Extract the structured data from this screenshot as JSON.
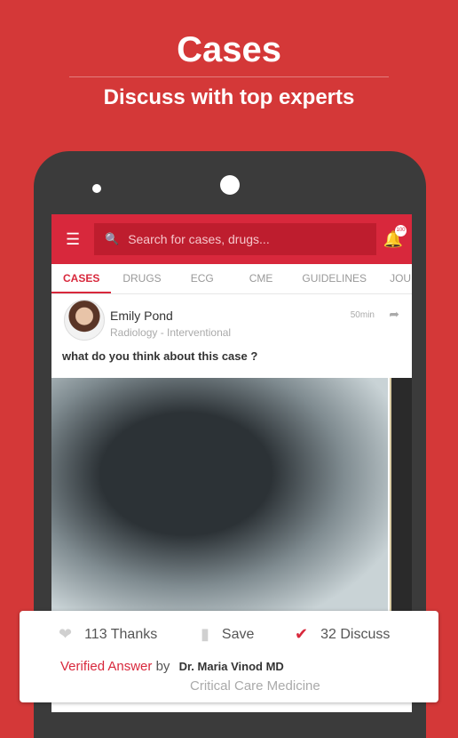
{
  "hero": {
    "title": "Cases",
    "subtitle": "Discuss with top experts"
  },
  "app": {
    "search_placeholder": "Search for cases, drugs...",
    "notification_badge": "100",
    "tabs": [
      {
        "label": "CASES",
        "active": true
      },
      {
        "label": "DRUGS"
      },
      {
        "label": "ECG"
      },
      {
        "label": "CME"
      },
      {
        "label": "GUIDELINES"
      },
      {
        "label": "JOURNA"
      }
    ],
    "post": {
      "author": "Emily Pond",
      "specialty": "Radiology - Interventional",
      "time": "50min",
      "question": "what do you think about this case ?"
    }
  },
  "card": {
    "thanks": "113 Thanks",
    "save": "Save",
    "discuss": "32 Discuss",
    "verified": "Verified Answer",
    "by": "by",
    "doctor": "Dr. Maria Vinod MD",
    "doctor_specialty": "Critical Care Medicine"
  },
  "colors": {
    "background": "#d43838",
    "accent": "#d8283c"
  }
}
